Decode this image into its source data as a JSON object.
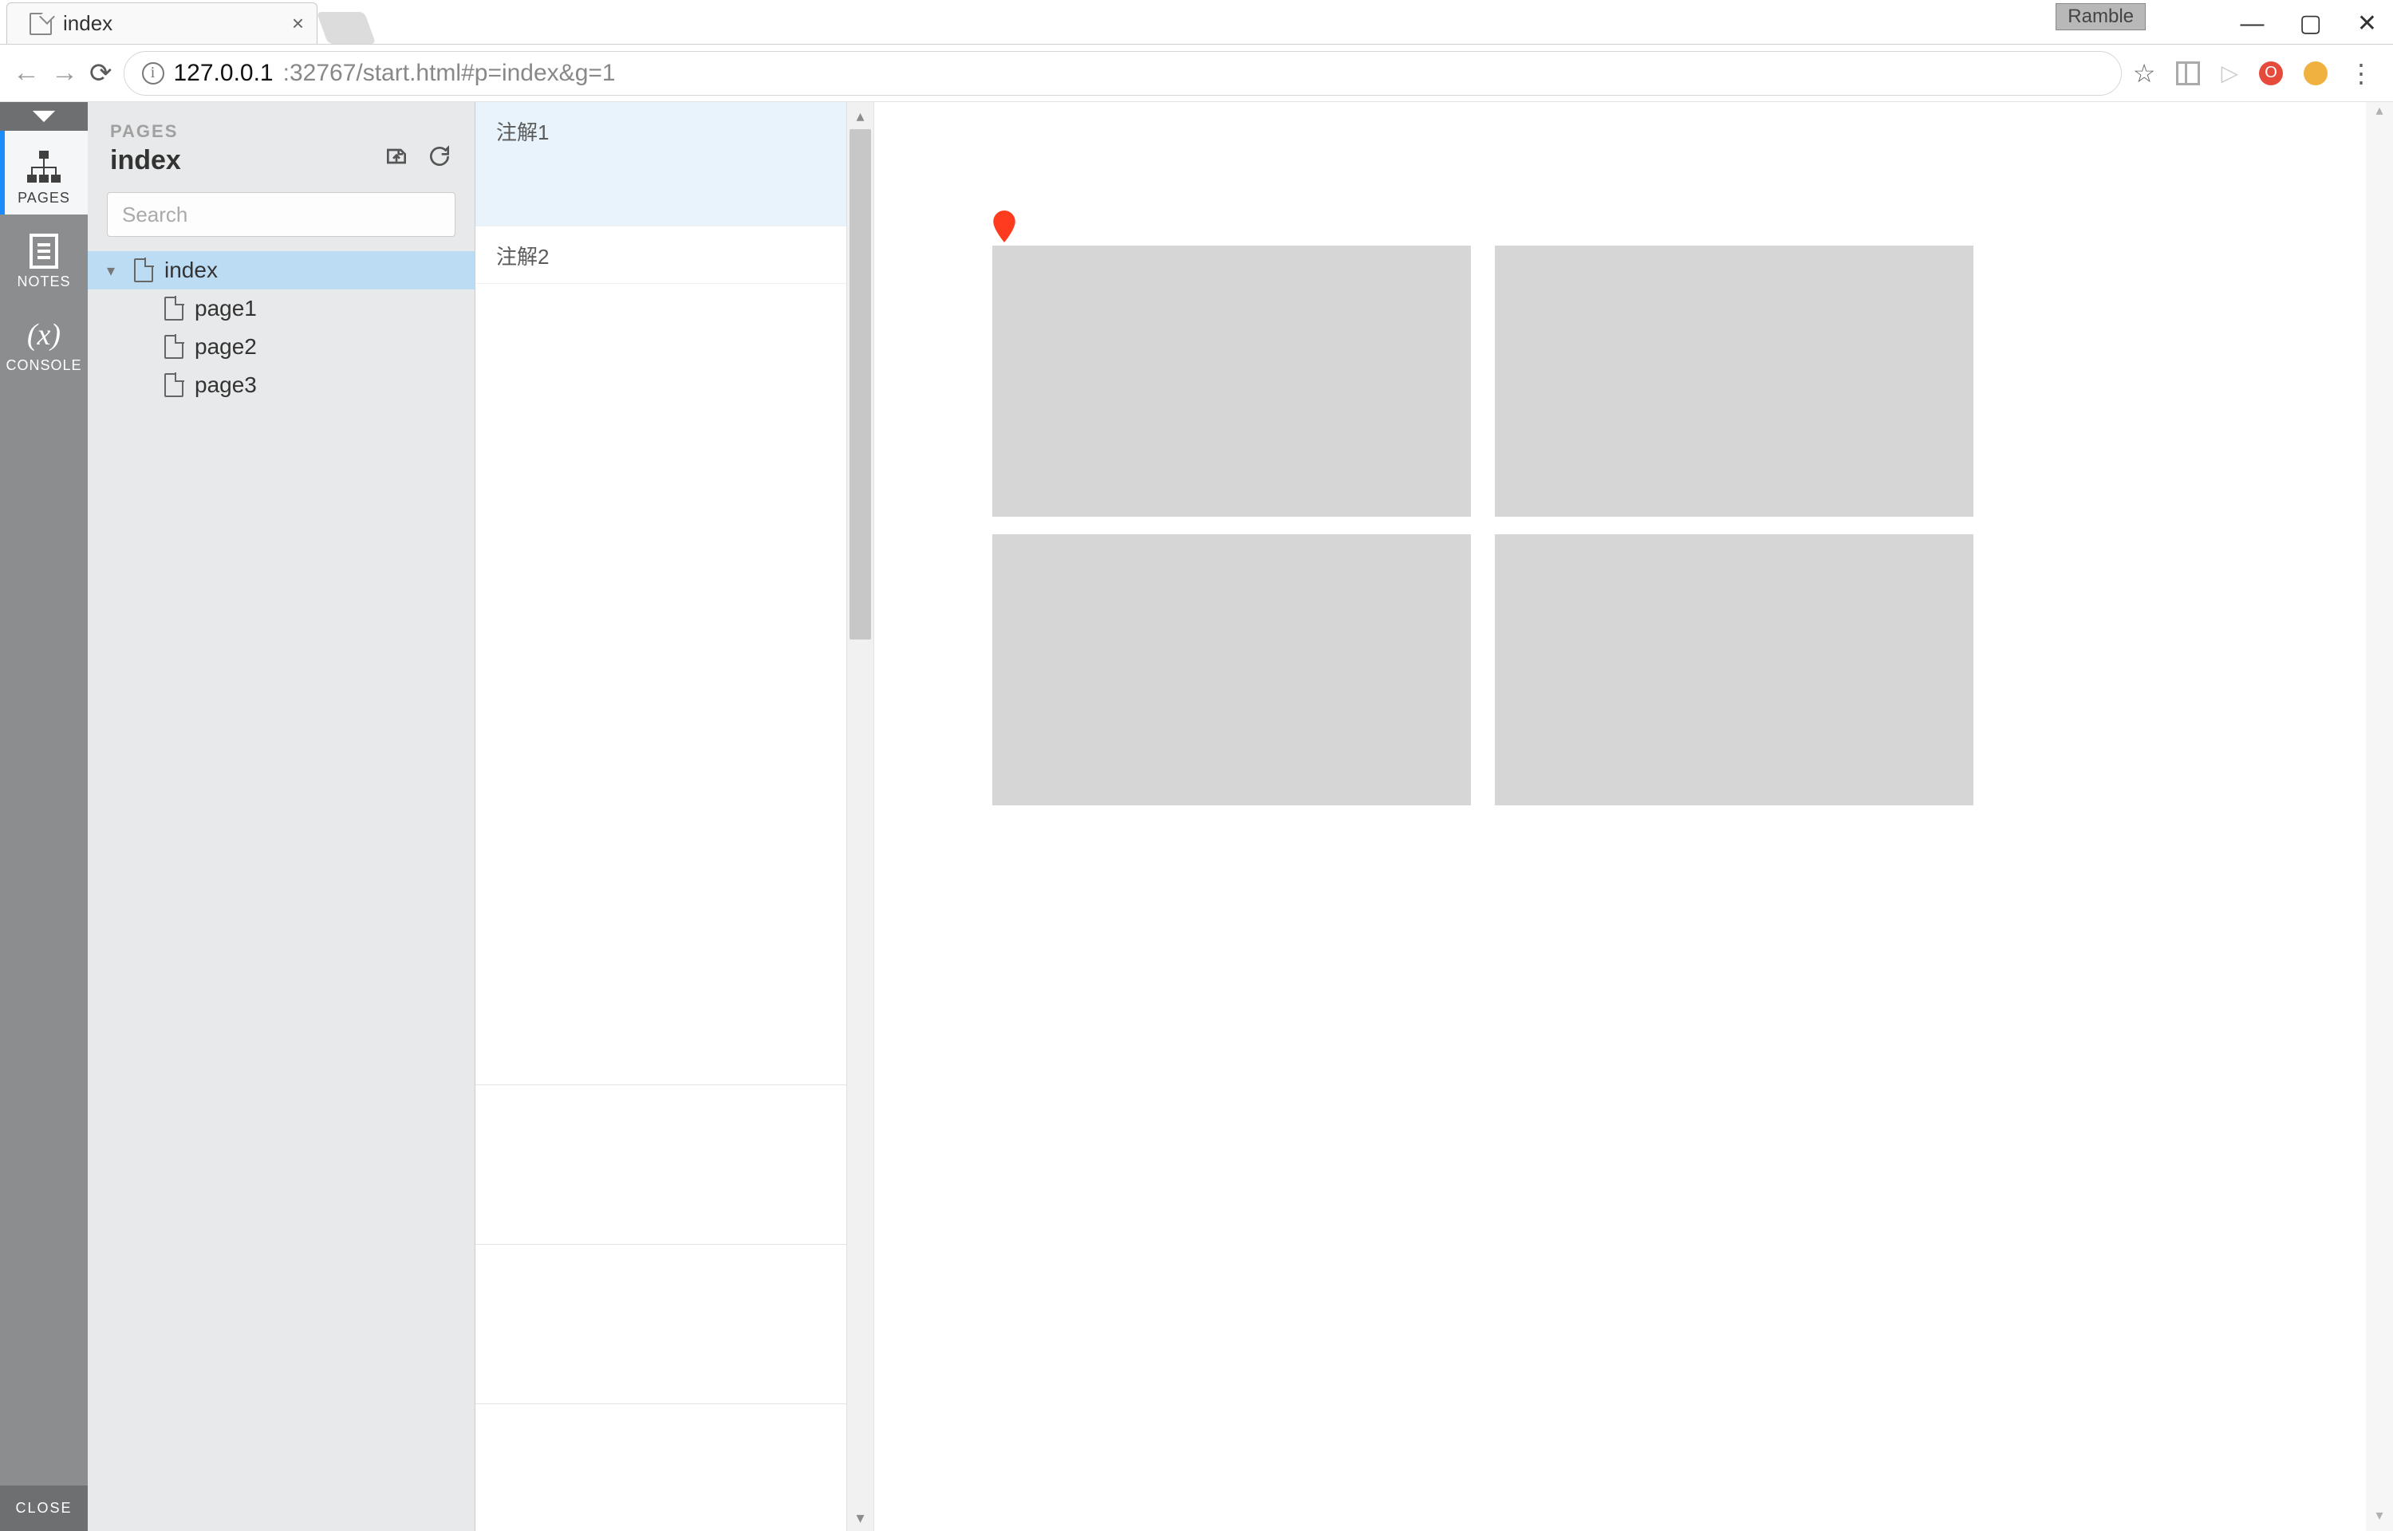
{
  "browser": {
    "tab_title": "index",
    "url_host": "127.0.0.1",
    "url_rest": ":32767/start.html#p=index&g=1",
    "badge": "Ramble"
  },
  "rail": {
    "pages": "PAGES",
    "notes": "NOTES",
    "console": "CONSOLE",
    "close": "CLOSE"
  },
  "sidebar": {
    "heading": "PAGES",
    "current": "index",
    "search_placeholder": "Search",
    "tree": {
      "root": "index",
      "children": [
        "page1",
        "page2",
        "page3"
      ]
    }
  },
  "notes": {
    "items": [
      "注解1",
      "注解2"
    ]
  }
}
